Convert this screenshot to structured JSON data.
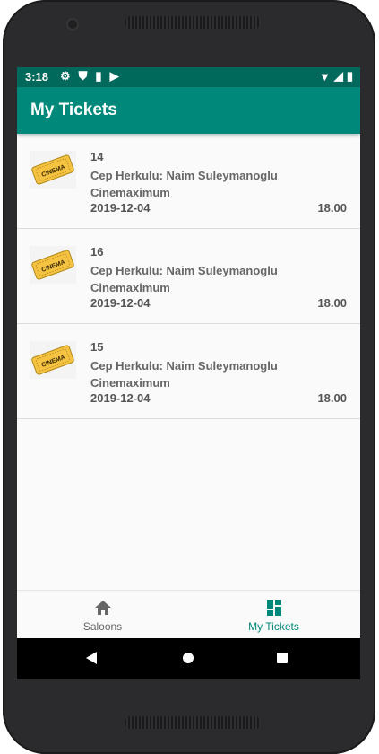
{
  "status_bar": {
    "time": "3:18",
    "left_icons": [
      "settings-icon",
      "shield-icon",
      "sd-card-icon",
      "play-store-icon"
    ],
    "right_icons": [
      "wifi-icon",
      "signal-icon",
      "battery-icon"
    ]
  },
  "app_bar": {
    "title": "My Tickets"
  },
  "tickets": [
    {
      "id": "14",
      "title": "Cep Herkulu: Naim Suleymanoglu Cinemaximum",
      "date": "2019-12-04",
      "price": "18.00",
      "icon_text": "CINEMA"
    },
    {
      "id": "16",
      "title": "Cep Herkulu: Naim Suleymanoglu Cinemaximum",
      "date": "2019-12-04",
      "price": "18.00",
      "icon_text": "CINEMA"
    },
    {
      "id": "15",
      "title": "Cep Herkulu: Naim Suleymanoglu Cinemaximum",
      "date": "2019-12-04",
      "price": "18.00",
      "icon_text": "CINEMA"
    }
  ],
  "bottom_nav": {
    "items": [
      {
        "label": "Saloons",
        "icon": "home-icon",
        "selected": false
      },
      {
        "label": "My Tickets",
        "icon": "dashboard-icon",
        "selected": true
      }
    ]
  },
  "colors": {
    "status_bar": "#00695c",
    "app_bar": "#00897b",
    "accent": "#00897b",
    "ticket_yellow": "#f5c242"
  }
}
